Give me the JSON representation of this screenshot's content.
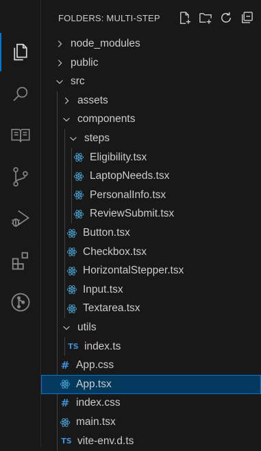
{
  "explorer": {
    "title": "FOLDERS: MULTI-STEP",
    "actions": [
      {
        "name": "new-file-icon"
      },
      {
        "name": "new-folder-icon"
      },
      {
        "name": "refresh-icon"
      },
      {
        "name": "collapse-all-icon"
      }
    ]
  },
  "activity_bar": [
    {
      "name": "explorer-icon",
      "active": true
    },
    {
      "name": "search-icon",
      "active": false
    },
    {
      "name": "book-icon",
      "active": false
    },
    {
      "name": "source-control-icon",
      "active": false
    },
    {
      "name": "run-debug-icon",
      "active": false
    },
    {
      "name": "extensions-icon",
      "active": false
    },
    {
      "name": "git-graph-icon",
      "active": false
    }
  ],
  "tree": [
    {
      "label": "node_modules",
      "kind": "folder",
      "open": false,
      "depth": 0
    },
    {
      "label": "public",
      "kind": "folder",
      "open": false,
      "depth": 0
    },
    {
      "label": "src",
      "kind": "folder",
      "open": true,
      "depth": 0
    },
    {
      "label": "assets",
      "kind": "folder",
      "open": false,
      "depth": 1
    },
    {
      "label": "components",
      "kind": "folder",
      "open": true,
      "depth": 1
    },
    {
      "label": "steps",
      "kind": "folder",
      "open": true,
      "depth": 2
    },
    {
      "label": "Eligibility.tsx",
      "kind": "react",
      "depth": 3
    },
    {
      "label": "LaptopNeeds.tsx",
      "kind": "react",
      "depth": 3
    },
    {
      "label": "PersonalInfo.tsx",
      "kind": "react",
      "depth": 3
    },
    {
      "label": "ReviewSubmit.tsx",
      "kind": "react",
      "depth": 3
    },
    {
      "label": "Button.tsx",
      "kind": "react",
      "depth": 2
    },
    {
      "label": "Checkbox.tsx",
      "kind": "react",
      "depth": 2
    },
    {
      "label": "HorizontalStepper.tsx",
      "kind": "react",
      "depth": 2
    },
    {
      "label": "Input.tsx",
      "kind": "react",
      "depth": 2
    },
    {
      "label": "Textarea.tsx",
      "kind": "react",
      "depth": 2
    },
    {
      "label": "utils",
      "kind": "folder",
      "open": true,
      "depth": 1
    },
    {
      "label": "index.ts",
      "kind": "ts",
      "depth": 2
    },
    {
      "label": "App.css",
      "kind": "css",
      "depth": 1
    },
    {
      "label": "App.tsx",
      "kind": "react",
      "depth": 1,
      "selected": true
    },
    {
      "label": "index.css",
      "kind": "css",
      "depth": 1
    },
    {
      "label": "main.tsx",
      "kind": "react",
      "depth": 1
    },
    {
      "label": "vite-env.d.ts",
      "kind": "ts",
      "depth": 1
    }
  ],
  "colors": {
    "accent": "#0078d4",
    "react": "#4aa8d8",
    "ts": "#3b8fd6",
    "background": "#181818",
    "selected_bg": "#04395e"
  }
}
